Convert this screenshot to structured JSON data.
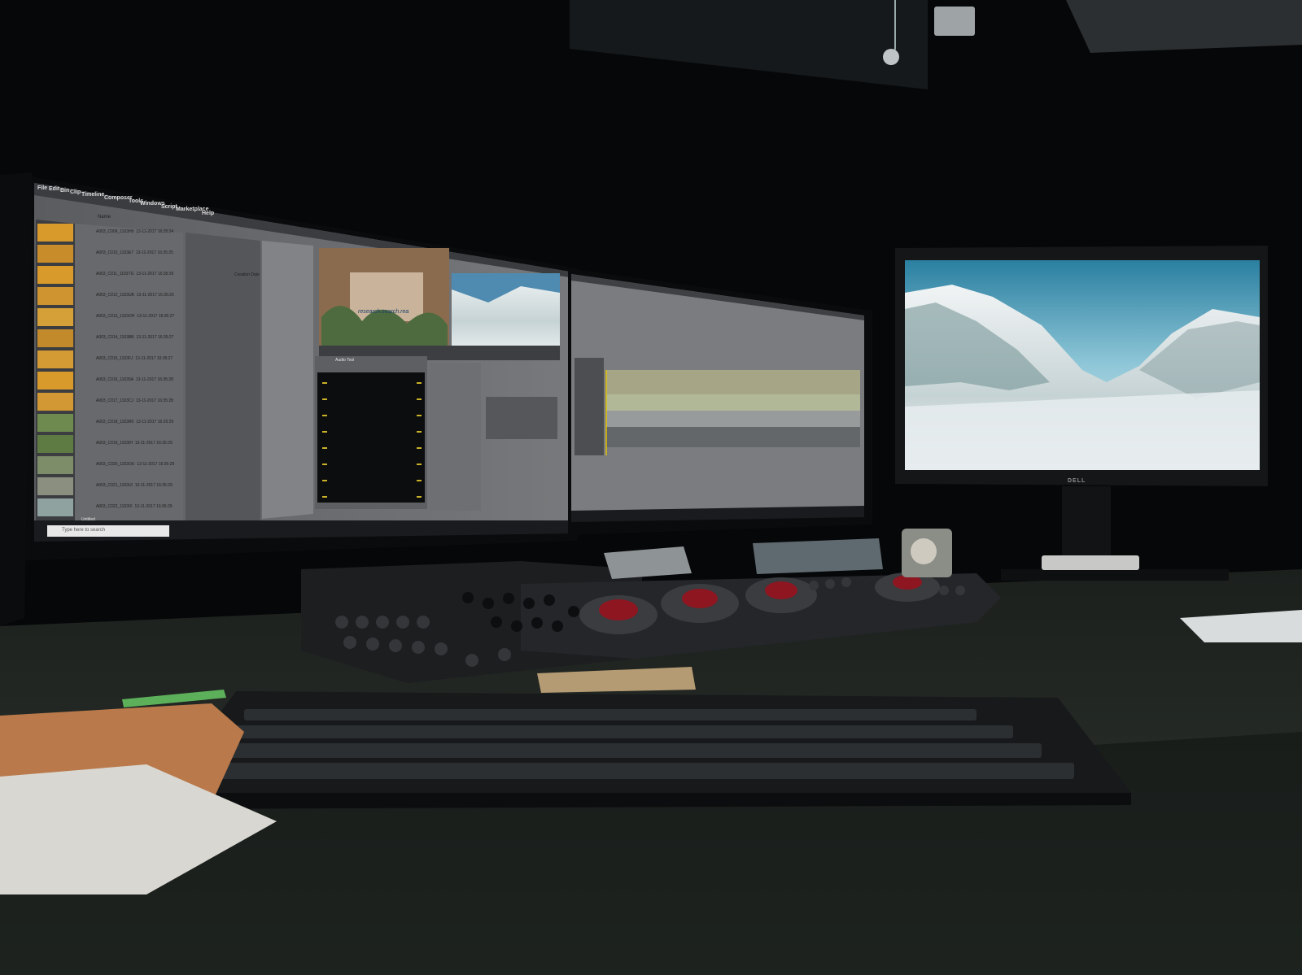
{
  "scene": {
    "description_tag": "editing-suite-photo",
    "left_monitor": {
      "menu": [
        "File",
        "Edit",
        "Bin",
        "Clip",
        "Timeline",
        "Composer",
        "Tools",
        "Windows",
        "Script",
        "Marketplace",
        "Help"
      ],
      "bin_column_header": "Name",
      "clips": [
        {
          "name": "A003_C009_1103H9",
          "date": "13-11-2017 16:35:24"
        },
        {
          "name": "A003_C010_1103E7",
          "date": "13-11-2017 16:35:25"
        },
        {
          "name": "A003_C011_1103TG",
          "date": "13-11-2017 16:35:26"
        },
        {
          "name": "A003_C012_1103UB",
          "date": "13-11-2017 16:35:26"
        },
        {
          "name": "A003_C013_1103OH",
          "date": "13-11-2017 16:35:27"
        },
        {
          "name": "A003_C014_1103BB",
          "date": "13-11-2017 16:35:27"
        },
        {
          "name": "A003_C015_1103FJ",
          "date": "13-11-2017 16:35:27"
        },
        {
          "name": "A003_C016_11035A",
          "date": "13-11-2017 16:35:28"
        },
        {
          "name": "A003_C017_1103CJ",
          "date": "13-11-2017 16:35:28"
        },
        {
          "name": "A003_C018_1103R0",
          "date": "13-11-2017 16:35:29"
        },
        {
          "name": "A003_C019_1103IH",
          "date": "13-11-2017 16:35:29"
        },
        {
          "name": "A003_C020_1103OU",
          "date": "13-11-2017 16:35:29"
        },
        {
          "name": "A003_C021_1103UI",
          "date": "13-11-2017 16:35:29"
        },
        {
          "name": "A003_C022_1103IX",
          "date": "13-11-2017 16:35:29"
        }
      ],
      "creation_date_header": "Creation Date",
      "source_label": "research.search.rea",
      "audio_tool_title": "Audio Tool",
      "taskbar_search": "Type here to search",
      "untitled_label": "Untitled"
    },
    "right_monitor_brand": "DELL",
    "colors": {
      "screen_gray": "#6b6d70",
      "panel_dark": "#2a2b2e",
      "accent_yellow": "#c9a227",
      "accent_green": "#7bbf3f"
    }
  }
}
